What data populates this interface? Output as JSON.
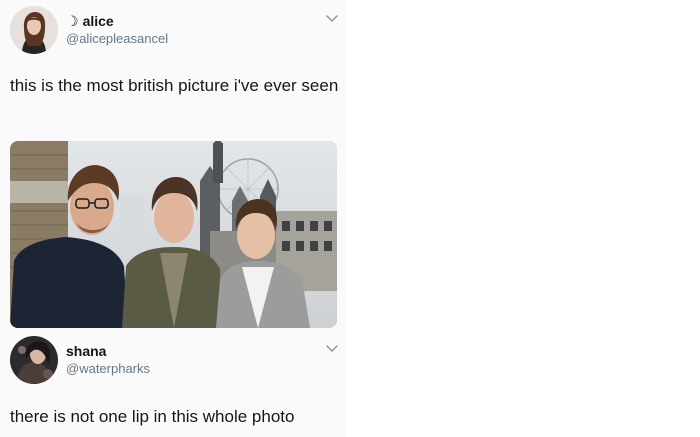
{
  "tweet1": {
    "name_prefix": "☽",
    "display_name": "alice",
    "handle": "@alicepleasancel",
    "text": "this is the most british picture i've ever seen",
    "menu_icon": "chevron-down-icon",
    "avatar_icon": "user-avatar"
  },
  "photo": {
    "description_icon": "photo-three-men-london-skyline"
  },
  "tweet2": {
    "display_name": "shana",
    "handle": "@waterpharks",
    "text": "there is not one lip in this whole photo",
    "menu_icon": "chevron-down-icon",
    "avatar_icon": "user-avatar"
  },
  "colors": {
    "text_primary": "#14171a",
    "text_secondary": "#657786",
    "background": "#fafafa"
  }
}
